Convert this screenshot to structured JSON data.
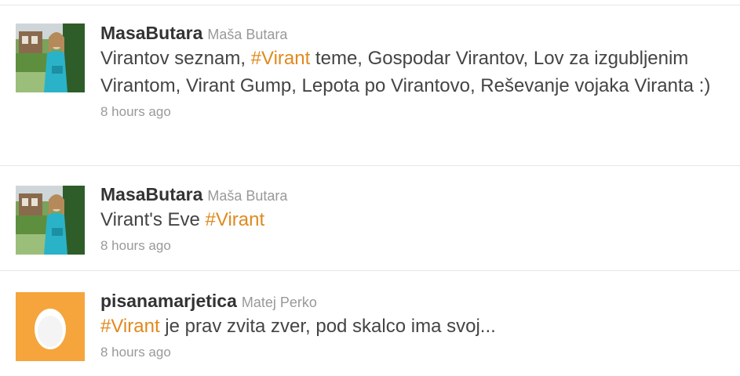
{
  "tweets": [
    {
      "screen_name": "MasaButara",
      "full_name": "Maša Butara",
      "avatar": "photo-girl-garden",
      "text_segments": [
        {
          "type": "text",
          "value": "Virantov seznam, "
        },
        {
          "type": "hashtag",
          "value": "#Virant"
        },
        {
          "type": "text",
          "value": " teme, Gospodar Virantov, Lov za izgubljenim Virantom, Virant Gump, Lepota po Virantovo, Reševanje vojaka Viranta :)"
        }
      ],
      "time": "8 hours ago"
    },
    {
      "screen_name": "MasaButara",
      "full_name": "Maša Butara",
      "avatar": "photo-girl-garden",
      "text_segments": [
        {
          "type": "text",
          "value": "Virant's Eve "
        },
        {
          "type": "hashtag",
          "value": "#Virant"
        }
      ],
      "time": "8 hours ago"
    },
    {
      "screen_name": "pisanamarjetica",
      "full_name": "Matej Perko",
      "avatar": "default-egg",
      "text_segments": [
        {
          "type": "hashtag",
          "value": "#Virant"
        },
        {
          "type": "text",
          "value": " je prav zvita zver, pod skalco ima svoj..."
        }
      ],
      "time": "8 hours ago"
    }
  ],
  "colors": {
    "hashtag": "#e0891d",
    "screen_name": "#333333",
    "muted": "#999999",
    "body_text": "#444444",
    "egg_bg": "#f5a53c",
    "divider": "#e6e6e6"
  }
}
